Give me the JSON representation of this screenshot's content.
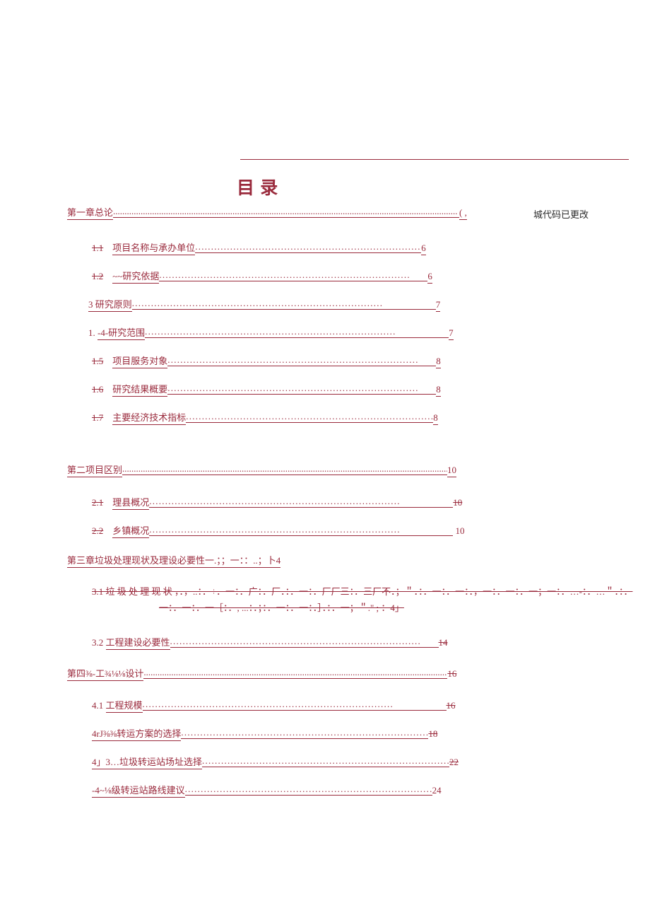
{
  "title": "目 录",
  "annotation": "城代码已更改",
  "ch1": {
    "label": "第一章总论",
    "suffix": "( ,"
  },
  "s11": {
    "num": "1.1",
    "label": "项目名称与承办单位",
    "page": "6"
  },
  "s12": {
    "num": "1.2",
    "label": "~~研究依据",
    "page": "6"
  },
  "s13": {
    "num": "3",
    "label": "研究原则",
    "page": "7"
  },
  "s14": {
    "num": "1.",
    "label": "-4-研究范围",
    "page": "7"
  },
  "s15": {
    "num": "1.5",
    "label": "项目服务对象",
    "page": "8"
  },
  "s16": {
    "num": "1.6",
    "label": "研究结果概要",
    "page": "8"
  },
  "s17": {
    "num": "1.7",
    "label": "主要经济技术指标",
    "page": "8"
  },
  "ch2": {
    "label": "第二项目区别",
    "page": "10"
  },
  "s21": {
    "num": "2.1",
    "label": "理县概况",
    "page": "10"
  },
  "s22": {
    "num": "2.2",
    "label": "乡镇概况",
    "page": "10"
  },
  "ch3": {
    "label": "第三章垃圾处理现状及理设必要性一.；；一：：..；卜4"
  },
  "s31": {
    "text": "3.1 垃 圾 处 理 现 状 ，．，..：．÷．一：．广：．厂．：．一：．厂厂三：．三厂不．；＂．：．一：．一：．，一：．一：．一；一：．…-：．…＂．：．一：．一：．一［：．, ...：．；：．一：．一：．］．：．一；＂.\" ; ：4」"
  },
  "s32": {
    "num": "3.2",
    "label": "工程建设必要性",
    "page": "14"
  },
  "ch4": {
    "label": "第四⅜-工¾⅛⅛设计",
    "page": "16"
  },
  "s41": {
    "num": "4.1",
    "label": "工程规模",
    "page": "16"
  },
  "s42": {
    "num": "",
    "label": "4rJ⅜⅜转运方案的选择",
    "page": "18"
  },
  "s43": {
    "num": "",
    "label": "4」3…垃圾转运站场址选择",
    "page": "22"
  },
  "s44": {
    "num": "",
    "label": "-4~⅛级转运站路线建议",
    "page": "24"
  }
}
